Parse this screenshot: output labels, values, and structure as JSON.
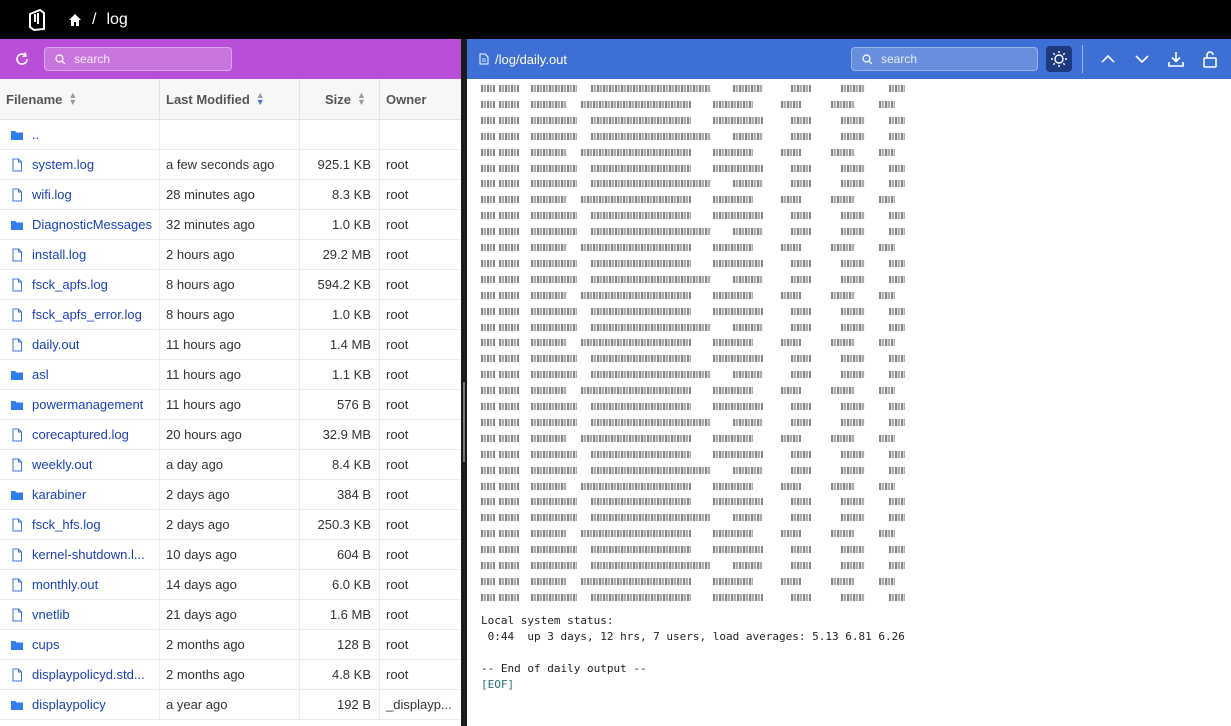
{
  "breadcrumb": {
    "current": "log",
    "separator": "/"
  },
  "left_panel": {
    "search_placeholder": "search",
    "columns": {
      "filename": "Filename",
      "modified": "Last Modified",
      "size": "Size",
      "owner": "Owner"
    },
    "rows": [
      {
        "type": "folder",
        "name": "..",
        "modified": "",
        "size": "",
        "owner": ""
      },
      {
        "type": "file",
        "name": "system.log",
        "modified": "a few seconds ago",
        "size": "925.1 KB",
        "owner": "root"
      },
      {
        "type": "file",
        "name": "wifi.log",
        "modified": "28 minutes ago",
        "size": "8.3 KB",
        "owner": "root"
      },
      {
        "type": "folder",
        "name": "DiagnosticMessages",
        "modified": "32 minutes ago",
        "size": "1.0 KB",
        "owner": "root"
      },
      {
        "type": "file",
        "name": "install.log",
        "modified": "2 hours ago",
        "size": "29.2 MB",
        "owner": "root"
      },
      {
        "type": "file",
        "name": "fsck_apfs.log",
        "modified": "8 hours ago",
        "size": "594.2 KB",
        "owner": "root"
      },
      {
        "type": "file",
        "name": "fsck_apfs_error.log",
        "modified": "8 hours ago",
        "size": "1.0 KB",
        "owner": "root"
      },
      {
        "type": "file",
        "name": "daily.out",
        "modified": "11 hours ago",
        "size": "1.4 MB",
        "owner": "root"
      },
      {
        "type": "folder",
        "name": "asl",
        "modified": "11 hours ago",
        "size": "1.1 KB",
        "owner": "root"
      },
      {
        "type": "folder",
        "name": "powermanagement",
        "modified": "11 hours ago",
        "size": "576 B",
        "owner": "root"
      },
      {
        "type": "file",
        "name": "corecaptured.log",
        "modified": "20 hours ago",
        "size": "32.9 MB",
        "owner": "root"
      },
      {
        "type": "file",
        "name": "weekly.out",
        "modified": "a day ago",
        "size": "8.4 KB",
        "owner": "root"
      },
      {
        "type": "folder",
        "name": "karabiner",
        "modified": "2 days ago",
        "size": "384 B",
        "owner": "root"
      },
      {
        "type": "file",
        "name": "fsck_hfs.log",
        "modified": "2 days ago",
        "size": "250.3 KB",
        "owner": "root"
      },
      {
        "type": "file",
        "name": "kernel-shutdown.l...",
        "modified": "10 days ago",
        "size": "604 B",
        "owner": "root"
      },
      {
        "type": "file",
        "name": "monthly.out",
        "modified": "14 days ago",
        "size": "6.0 KB",
        "owner": "root"
      },
      {
        "type": "file",
        "name": "vnetlib",
        "modified": "21 days ago",
        "size": "1.6 MB",
        "owner": "root"
      },
      {
        "type": "folder",
        "name": "cups",
        "modified": "2 months ago",
        "size": "128 B",
        "owner": "root"
      },
      {
        "type": "file",
        "name": "displaypolicyd.std...",
        "modified": "2 months ago",
        "size": "4.8 KB",
        "owner": "root"
      },
      {
        "type": "folder",
        "name": "displaypolicy",
        "modified": "a year ago",
        "size": "192 B",
        "owner": "_displayp..."
      }
    ]
  },
  "right_panel": {
    "file_path": "/log/daily.out",
    "search_placeholder": "search",
    "lines": [
      "Local system status:",
      " 0:44  up 3 days, 12 hrs, 7 users, load averages: 5.13 6.81 6.26",
      "",
      "-- End of daily output --"
    ],
    "eof": "[EOF]"
  },
  "colors": {
    "left_toolbar": "#b94fd8",
    "right_toolbar": "#3e6fd5",
    "link": "#1a3fbd",
    "folder": "#2f7df0"
  }
}
